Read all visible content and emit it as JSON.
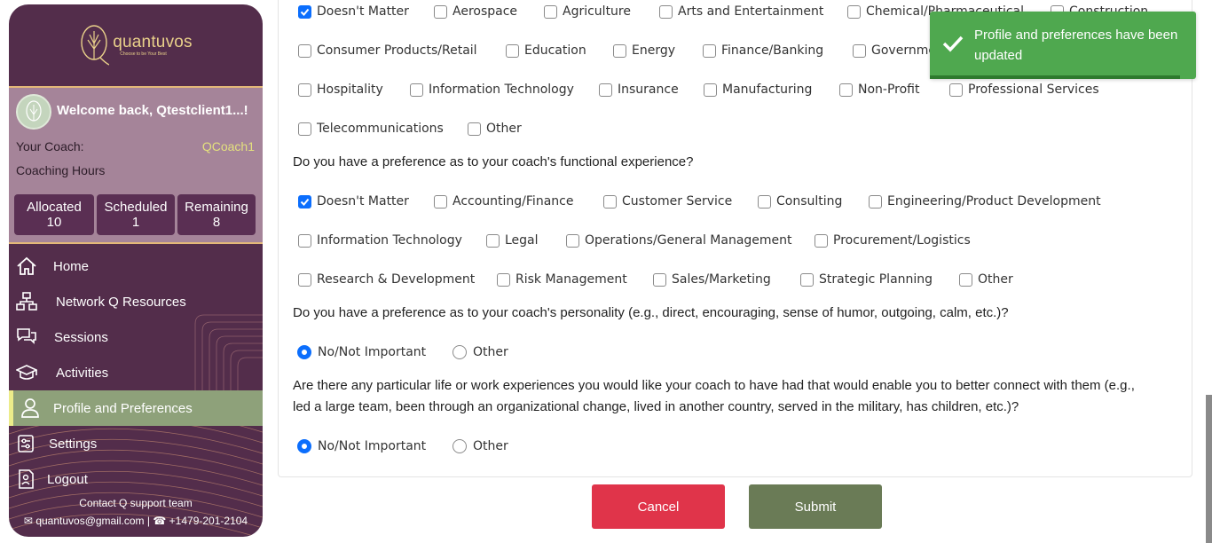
{
  "sidebar": {
    "logo": {
      "name": "quantuvos",
      "tagline": "Choose to be Your Best"
    },
    "welcome": "Welcome back, Qtestclient1...!",
    "coach_label": "Your Coach:",
    "coach_name": "QCoach1",
    "hours_label": "Coaching Hours",
    "stats": [
      {
        "label": "Allocated",
        "value": "10"
      },
      {
        "label": "Scheduled",
        "value": "1"
      },
      {
        "label": "Remaining",
        "value": "8"
      }
    ],
    "nav": [
      {
        "label": "Home",
        "icon": "home-icon"
      },
      {
        "label": "Network Q Resources",
        "icon": "network-icon"
      },
      {
        "label": "Sessions",
        "icon": "chat-icon"
      },
      {
        "label": "Activities",
        "icon": "graduation-cap-icon"
      },
      {
        "label": "Profile and Preferences",
        "icon": "user-icon",
        "active": true
      },
      {
        "label": "Settings",
        "icon": "settings-icon"
      },
      {
        "label": "Logout",
        "icon": "logout-icon"
      }
    ],
    "footer": {
      "contact": "Contact Q support team",
      "email": "quantuvos@gmail.com",
      "divider": "|",
      "phone": "+1479-201-2104"
    }
  },
  "industry": {
    "options": [
      {
        "label": "Doesn't Matter",
        "checked": true
      },
      {
        "label": "Aerospace",
        "checked": false
      },
      {
        "label": "Agriculture",
        "checked": false
      },
      {
        "label": "Arts and Entertainment",
        "checked": false
      },
      {
        "label": "Chemical/Pharmaceutical",
        "checked": false
      },
      {
        "label": "Construction",
        "checked": false
      },
      {
        "label": "Consumer Products/Retail",
        "checked": false
      },
      {
        "label": "Education",
        "checked": false
      },
      {
        "label": "Energy",
        "checked": false
      },
      {
        "label": "Finance/Banking",
        "checked": false
      },
      {
        "label": "Government",
        "checked": false
      },
      {
        "label": "Hospitality",
        "checked": false
      },
      {
        "label": "Information Technology",
        "checked": false
      },
      {
        "label": "Insurance",
        "checked": false
      },
      {
        "label": "Manufacturing",
        "checked": false
      },
      {
        "label": "Non-Profit",
        "checked": false
      },
      {
        "label": "Professional Services",
        "checked": false
      },
      {
        "label": "Telecommunications",
        "checked": false
      },
      {
        "label": "Other",
        "checked": false
      }
    ]
  },
  "functional": {
    "question": "Do you have a preference as to your coach's functional experience?",
    "options": [
      {
        "label": "Doesn't Matter",
        "checked": true
      },
      {
        "label": "Accounting/Finance",
        "checked": false
      },
      {
        "label": "Customer Service",
        "checked": false
      },
      {
        "label": "Consulting",
        "checked": false
      },
      {
        "label": "Engineering/Product Development",
        "checked": false
      },
      {
        "label": "Information Technology",
        "checked": false
      },
      {
        "label": "Legal",
        "checked": false
      },
      {
        "label": "Operations/General Management",
        "checked": false
      },
      {
        "label": "Procurement/Logistics",
        "checked": false
      },
      {
        "label": "Research & Development",
        "checked": false
      },
      {
        "label": "Risk Management",
        "checked": false
      },
      {
        "label": "Sales/Marketing",
        "checked": false
      },
      {
        "label": "Strategic Planning",
        "checked": false
      },
      {
        "label": "Other",
        "checked": false
      }
    ]
  },
  "personality": {
    "question": "Do you have a preference as to your coach's personality (e.g., direct, encouraging, sense of humor, outgoing, calm, etc.)?",
    "options": [
      {
        "label": "No/Not Important",
        "selected": true
      },
      {
        "label": "Other",
        "selected": false
      }
    ]
  },
  "experience": {
    "question_line1": "Are there any particular life or work experiences you would like your coach to have had that would enable you to better connect with them (e.g.,",
    "question_line2": "led a large team, been through an organizational change, lived in another country, served in the military, has children, etc.)?",
    "options": [
      {
        "label": "No/Not Important",
        "selected": true
      },
      {
        "label": "Other",
        "selected": false
      }
    ]
  },
  "buttons": {
    "cancel": "Cancel",
    "submit": "Submit"
  },
  "toast": {
    "message": "Profile and preferences have been updated"
  },
  "colors": {
    "sidebar": "#532d4b",
    "accent_gold": "#e3b878",
    "active_nav": "#8ea17a",
    "checkbox": "#0b6efd",
    "cancel": "#e0344a",
    "submit": "#6a7b56",
    "toast": "#4fa84f"
  }
}
